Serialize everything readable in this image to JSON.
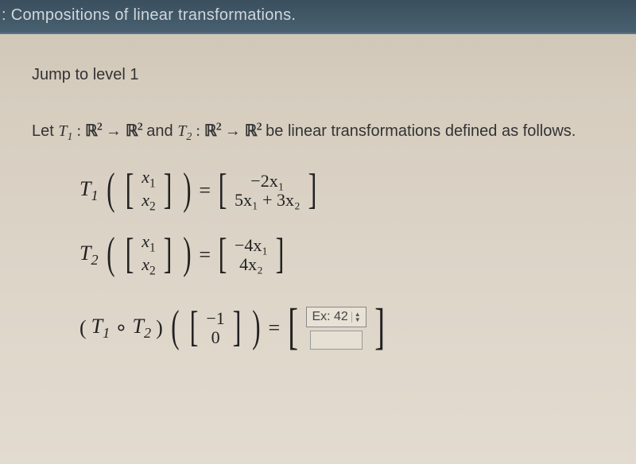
{
  "header": {
    "title": ": Compositions of linear transformations."
  },
  "jump": {
    "text": "Jump to level 1"
  },
  "intro": {
    "prefix": "Let ",
    "t1": "T",
    "t1_sub": "1",
    "colon": " : ",
    "R": "ℝ",
    "sq": "2",
    "arrow": " → ",
    "and": " and ",
    "t2": "T",
    "t2_sub": "2",
    "suffix": " be linear transformations defined as follows."
  },
  "eq1": {
    "lhs_T": "T",
    "lhs_sub": "1",
    "vec_top": "x",
    "vec_top_sub": "1",
    "vec_bot": "x",
    "vec_bot_sub": "2",
    "rhs_top": "−2x₁",
    "rhs_bot": "5x₁ + 3x₂"
  },
  "eq2": {
    "lhs_T": "T",
    "lhs_sub": "2",
    "vec_top": "x",
    "vec_top_sub": "1",
    "vec_bot": "x",
    "vec_bot_sub": "2",
    "rhs_top": "−4x₁",
    "rhs_bot": "4x₂"
  },
  "eq3": {
    "lhs_open": "(",
    "T1": "T",
    "T1_sub": "1",
    "circ": " ∘ ",
    "T2": "T",
    "T2_sub": "2",
    "lhs_close": ")",
    "vec_top": "−1",
    "vec_bot": "0",
    "answer_placeholder": "Ex: 42"
  }
}
